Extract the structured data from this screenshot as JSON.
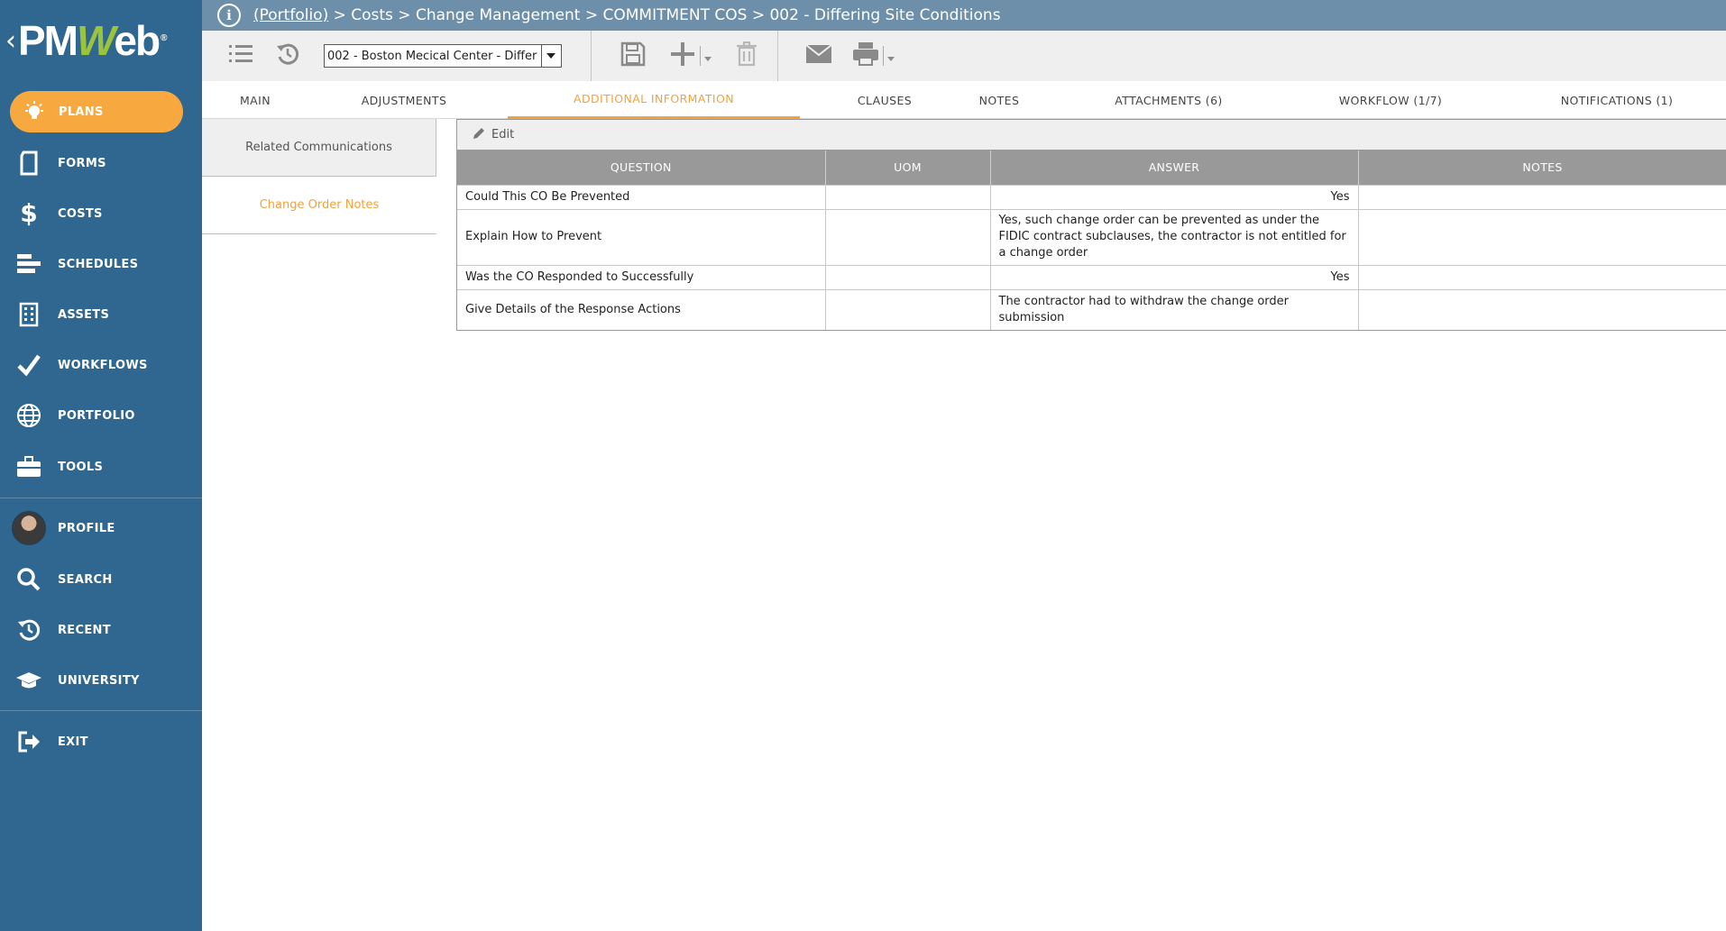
{
  "app": {
    "logo": {
      "prefix": "PM",
      "accent": "W",
      "suffix": "eb",
      "reg": "®"
    }
  },
  "sidebar": {
    "items": [
      {
        "label": "PLANS",
        "icon": "lightbulb-icon",
        "active": true
      },
      {
        "label": "FORMS",
        "icon": "document-icon"
      },
      {
        "label": "COSTS",
        "icon": "dollar-icon"
      },
      {
        "label": "SCHEDULES",
        "icon": "gantt-icon"
      },
      {
        "label": "ASSETS",
        "icon": "building-icon"
      },
      {
        "label": "WORKFLOWS",
        "icon": "checkmark-icon"
      },
      {
        "label": "PORTFOLIO",
        "icon": "globe-icon"
      },
      {
        "label": "TOOLS",
        "icon": "briefcase-icon"
      },
      {
        "label": "PROFILE",
        "icon": "avatar"
      },
      {
        "label": "SEARCH",
        "icon": "search-icon"
      },
      {
        "label": "RECENT",
        "icon": "history-icon"
      },
      {
        "label": "UNIVERSITY",
        "icon": "graduation-cap-icon"
      },
      {
        "label": "EXIT",
        "icon": "exit-icon"
      }
    ]
  },
  "header": {
    "breadcrumb_link": "(Portfolio)",
    "breadcrumb_rest": " > Costs > Change Management > COMMITMENT COS > 002 - Differing Site Conditions"
  },
  "toolbar": {
    "record_select_value": "002 - Boston Mecical Center - Differ"
  },
  "tabs": [
    {
      "label": "MAIN"
    },
    {
      "label": "ADJUSTMENTS"
    },
    {
      "label": "ADDITIONAL INFORMATION",
      "active": true
    },
    {
      "label": "CLAUSES"
    },
    {
      "label": "NOTES"
    },
    {
      "label": "ATTACHMENTS (6)"
    },
    {
      "label": "WORKFLOW (1/7)"
    },
    {
      "label": "NOTIFICATIONS (1)"
    }
  ],
  "subpanel": {
    "items": [
      {
        "label": "Related Communications"
      },
      {
        "label": "Change Order Notes",
        "selected": true
      }
    ]
  },
  "grid": {
    "edit_label": "Edit",
    "columns": [
      "QUESTION",
      "UOM",
      "ANSWER",
      "NOTES"
    ],
    "rows": [
      {
        "question": "Could This CO Be Prevented",
        "uom": "",
        "answer": "Yes",
        "notes": ""
      },
      {
        "question": "Explain How to Prevent",
        "uom": "",
        "answer": "Yes, such change order can be prevented as under the FIDIC contract subclauses, the contractor is not entitled for a change order",
        "notes": ""
      },
      {
        "question": "Was the CO Responded to Successfully",
        "uom": "",
        "answer": "Yes",
        "notes": ""
      },
      {
        "question": "Give Details of the Response Actions",
        "uom": "",
        "answer": "The contractor had to withdraw the change order submission",
        "notes": ""
      }
    ]
  },
  "colors": {
    "sidebar": "#2f6790",
    "accent": "#f7a940",
    "header": "#6d8fa9",
    "logo_accent": "#9bc43a"
  }
}
